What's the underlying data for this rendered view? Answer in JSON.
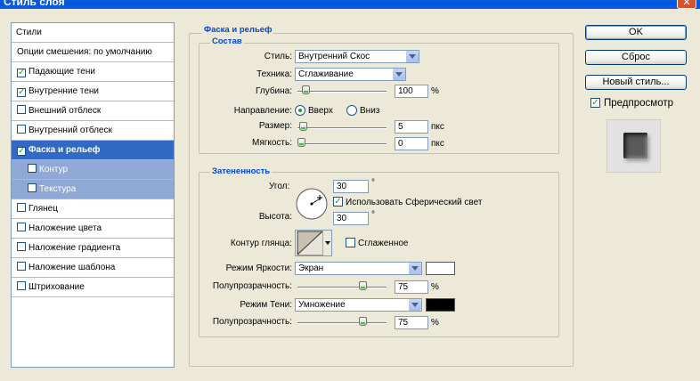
{
  "window": {
    "title": "Стиль слоя",
    "close_glyph": "✕"
  },
  "style_list": {
    "header": "Стили",
    "items": [
      {
        "label": "Опции смешения: по умолчанию",
        "checkbox": false,
        "checked": false,
        "selected": false,
        "sub": false
      },
      {
        "label": "Падающие тени",
        "checkbox": true,
        "checked": true,
        "selected": false,
        "sub": false
      },
      {
        "label": "Внутренние тени",
        "checkbox": true,
        "checked": true,
        "selected": false,
        "sub": false
      },
      {
        "label": "Внешний отблеск",
        "checkbox": true,
        "checked": false,
        "selected": false,
        "sub": false
      },
      {
        "label": "Внутренний отблеск",
        "checkbox": true,
        "checked": false,
        "selected": false,
        "sub": false
      },
      {
        "label": "Фаска и рельеф",
        "checkbox": true,
        "checked": true,
        "selected": true,
        "sub": false
      },
      {
        "label": "Контур",
        "checkbox": true,
        "checked": false,
        "selected": false,
        "sub": true
      },
      {
        "label": "Текстура",
        "checkbox": true,
        "checked": false,
        "selected": false,
        "sub": true
      },
      {
        "label": "Глянец",
        "checkbox": true,
        "checked": false,
        "selected": false,
        "sub": false
      },
      {
        "label": "Наложение цвета",
        "checkbox": true,
        "checked": false,
        "selected": false,
        "sub": false
      },
      {
        "label": "Наложение градиента",
        "checkbox": true,
        "checked": false,
        "selected": false,
        "sub": false
      },
      {
        "label": "Наложение шаблона",
        "checkbox": true,
        "checked": false,
        "selected": false,
        "sub": false
      },
      {
        "label": "Штрихование",
        "checkbox": true,
        "checked": false,
        "selected": false,
        "sub": false
      }
    ]
  },
  "bevel": {
    "title": "Фаска и рельеф",
    "structure": {
      "title": "Состав",
      "style_label": "Стиль:",
      "style_value": "Внутренний Скос",
      "technique_label": "Техника:",
      "technique_value": "Сглаживание",
      "depth_label": "Глубина:",
      "depth_value": "100",
      "depth_unit": "%",
      "depth_slider_fraction": 0.05,
      "direction_label": "Направление:",
      "direction_up": "Вверх",
      "direction_down": "Вниз",
      "direction_selected": "up",
      "size_label": "Размер:",
      "size_value": "5",
      "size_unit": "пкс",
      "size_slider_fraction": 0.02,
      "soften_label": "Мягкость:",
      "soften_value": "0",
      "soften_unit": "пкс",
      "soften_slider_fraction": 0.0
    },
    "shading": {
      "title": "Затененность",
      "angle_label": "Угол:",
      "angle_value": "30",
      "angle_unit": "°",
      "global_light_label": "Использовать Сферический свет",
      "global_light_checked": true,
      "altitude_label": "Высота:",
      "altitude_value": "30",
      "altitude_unit": "°",
      "gloss_contour_label": "Контур глянца:",
      "anti_aliased_label": "Сглаженное",
      "anti_aliased_checked": false,
      "highlight_mode_label": "Режим Яркости:",
      "highlight_mode_value": "Экран",
      "highlight_color": "#ffffff",
      "highlight_opacity_label": "Полупрозрачность:",
      "highlight_opacity_value": "75",
      "highlight_opacity_unit": "%",
      "highlight_opacity_fraction": 0.75,
      "shadow_mode_label": "Режим Тени:",
      "shadow_mode_value": "Умножение",
      "shadow_color": "#000000",
      "shadow_opacity_label": "Полупрозрачность:",
      "shadow_opacity_value": "75",
      "shadow_opacity_unit": "%",
      "shadow_opacity_fraction": 0.75
    }
  },
  "buttons": {
    "ok": "OK",
    "reset": "Сброс",
    "new_style": "Новый стиль...",
    "preview_label": "Предпросмотр",
    "preview_checked": true
  },
  "colors": {
    "dialog_bg": "#ece9d8",
    "selection": "#316ac5",
    "sub_item": "#8fa8d6",
    "group_title": "#0046d5",
    "check_green": "#21a121"
  }
}
